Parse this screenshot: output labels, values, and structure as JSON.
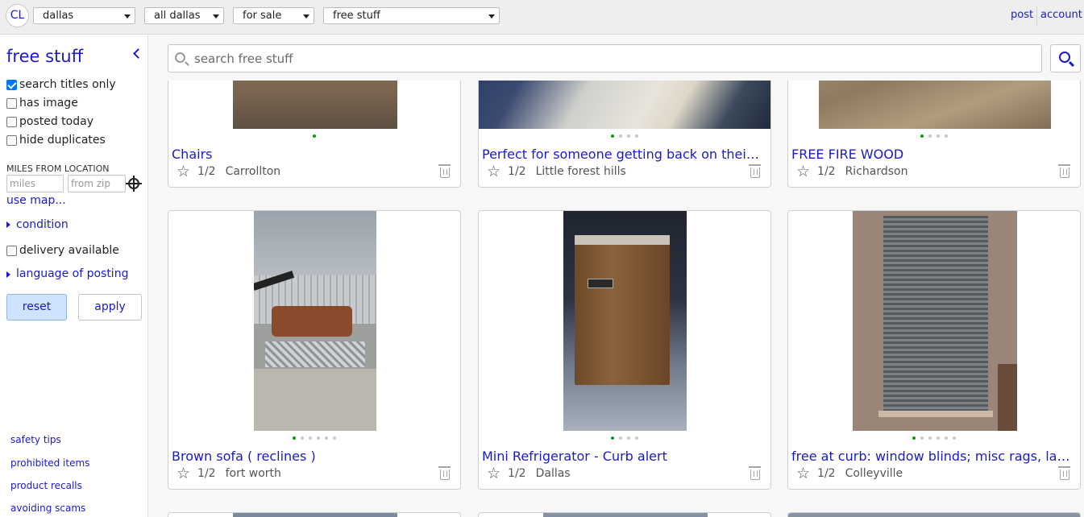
{
  "header": {
    "logo": "CL",
    "location": "dallas",
    "area": "all dallas",
    "category": "for sale",
    "subcategory": "free stuff",
    "post_link": "post",
    "account_link": "account"
  },
  "sidebar": {
    "title": "free stuff",
    "filters": [
      {
        "label": "search titles only",
        "checked": true
      },
      {
        "label": "has image",
        "checked": false
      },
      {
        "label": "posted today",
        "checked": false
      },
      {
        "label": "hide duplicates",
        "checked": false
      }
    ],
    "miles_label": "MILES FROM LOCATION",
    "miles_placeholder": "miles",
    "zip_placeholder": "from zip",
    "use_map": "use map...",
    "condition": "condition",
    "delivery_label": "delivery available",
    "language": "language of posting",
    "reset": "reset",
    "apply": "apply",
    "footer_links": [
      "safety tips",
      "prohibited items",
      "product recalls",
      "avoiding scams"
    ]
  },
  "search": {
    "placeholder": "search free stuff"
  },
  "listings": [
    {
      "title": "Chairs",
      "images": "1/2",
      "location": "Carrollton",
      "dots": 1
    },
    {
      "title": "Perfect for someone getting back on their feet",
      "images": "1/2",
      "location": "Little forest hills",
      "dots": 4
    },
    {
      "title": "FREE FIRE WOOD",
      "images": "1/2",
      "location": "Richardson",
      "dots": 4
    },
    {
      "title": "Brown sofa ( reclines )",
      "images": "1/2",
      "location": "fort worth",
      "dots": 6
    },
    {
      "title": "Mini Refrigerator - Curb alert",
      "images": "1/2",
      "location": "Dallas",
      "dots": 4
    },
    {
      "title": "free at curb: window blinds; misc rags, laundry basket",
      "images": "1/2",
      "location": "Colleyville",
      "dots": 6
    }
  ],
  "colors": {
    "link": "#1a1acc",
    "active_dot": "#0a9a0a",
    "reset_bg": "#cfe2ff"
  }
}
